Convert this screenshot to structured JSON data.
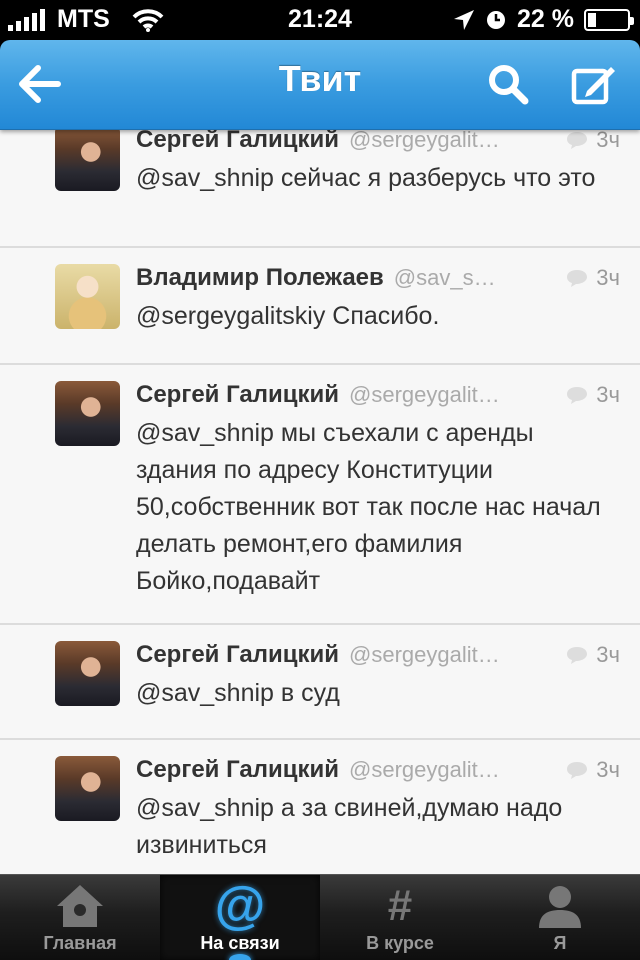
{
  "status_bar": {
    "carrier": "MTS",
    "time": "21:24",
    "battery_text": "22 %",
    "battery_level": 0.22,
    "icons": [
      "signal-bars-icon",
      "wifi-icon",
      "location-arrow-icon",
      "alarm-clock-icon",
      "battery-icon"
    ]
  },
  "nav": {
    "title": "Твит",
    "icons": [
      "back-arrow-icon",
      "search-icon",
      "compose-icon"
    ]
  },
  "tweets": [
    {
      "author": "Сергей Галицкий",
      "handle": "@sergeygalit…",
      "time": "3ч",
      "text": "@sav_shnip сейчас я разберусь что это",
      "avatar": "sergey"
    },
    {
      "author": "Владимир Полежаев",
      "handle": "@sav_s…",
      "time": "3ч",
      "text": "@sergeygalitskiy Спасибо.",
      "avatar": "vlad"
    },
    {
      "author": "Сергей Галицкий",
      "handle": "@sergeygalit…",
      "time": "3ч",
      "text": "@sav_shnip мы съехали с аренды здания  по адресу Конституции 50,собственник вот так после нас начал делать ремонт,его фамилия Бойко,подавайт",
      "avatar": "sergey"
    },
    {
      "author": "Сергей Галицкий",
      "handle": "@sergeygalit…",
      "time": "3ч",
      "text": "@sav_shnip в суд",
      "avatar": "sergey"
    },
    {
      "author": "Сергей Галицкий",
      "handle": "@sergeygalit…",
      "time": "3ч",
      "text": "@sav_shnip а за свиней,думаю надо извиниться",
      "avatar": "sergey"
    }
  ],
  "tabs": [
    {
      "label": "Главная",
      "icon": "home-icon",
      "active": false
    },
    {
      "label": "На связи",
      "icon": "at-sign-icon",
      "active": true
    },
    {
      "label": "В курсе",
      "icon": "hashtag-icon",
      "active": false
    },
    {
      "label": "Я",
      "icon": "person-icon",
      "active": false
    }
  ],
  "colors": {
    "nav_blue": "#3a9ce0",
    "accent": "#37a4ec",
    "background": "#f7f7f7"
  }
}
